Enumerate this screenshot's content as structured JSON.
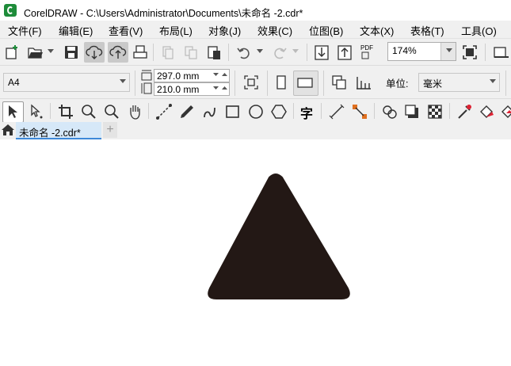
{
  "window": {
    "title": "CorelDRAW - C:\\Users\\Administrator\\Documents\\未命名 -2.cdr*",
    "app_icon": "coreldraw-logo"
  },
  "menu": [
    {
      "label": "文件(F)"
    },
    {
      "label": "编辑(E)"
    },
    {
      "label": "查看(V)"
    },
    {
      "label": "布局(L)"
    },
    {
      "label": "对象(J)"
    },
    {
      "label": "效果(C)"
    },
    {
      "label": "位图(B)"
    },
    {
      "label": "文本(X)"
    },
    {
      "label": "表格(T)"
    },
    {
      "label": "工具(O)"
    }
  ],
  "standard_toolbar": {
    "zoom_value": "174%",
    "pdf_label": "PDF"
  },
  "property_bar": {
    "page_size": "A4",
    "width": "297.0 mm",
    "height": "210.0 mm",
    "units_label": "单位:",
    "units_value": "毫米"
  },
  "toolbox": {
    "text_tool_glyph": "字"
  },
  "tabs": {
    "document_tab": "未命名 -2.cdr*",
    "add_tab": "+"
  },
  "canvas": {
    "shape": "triangle",
    "shape_fill": "#231815"
  },
  "colors": {
    "chrome": "#f0f0f0",
    "active_tab": "#d6e8f8",
    "tab_underline": "#3d88d8",
    "app_green": "#1e8c3a"
  }
}
